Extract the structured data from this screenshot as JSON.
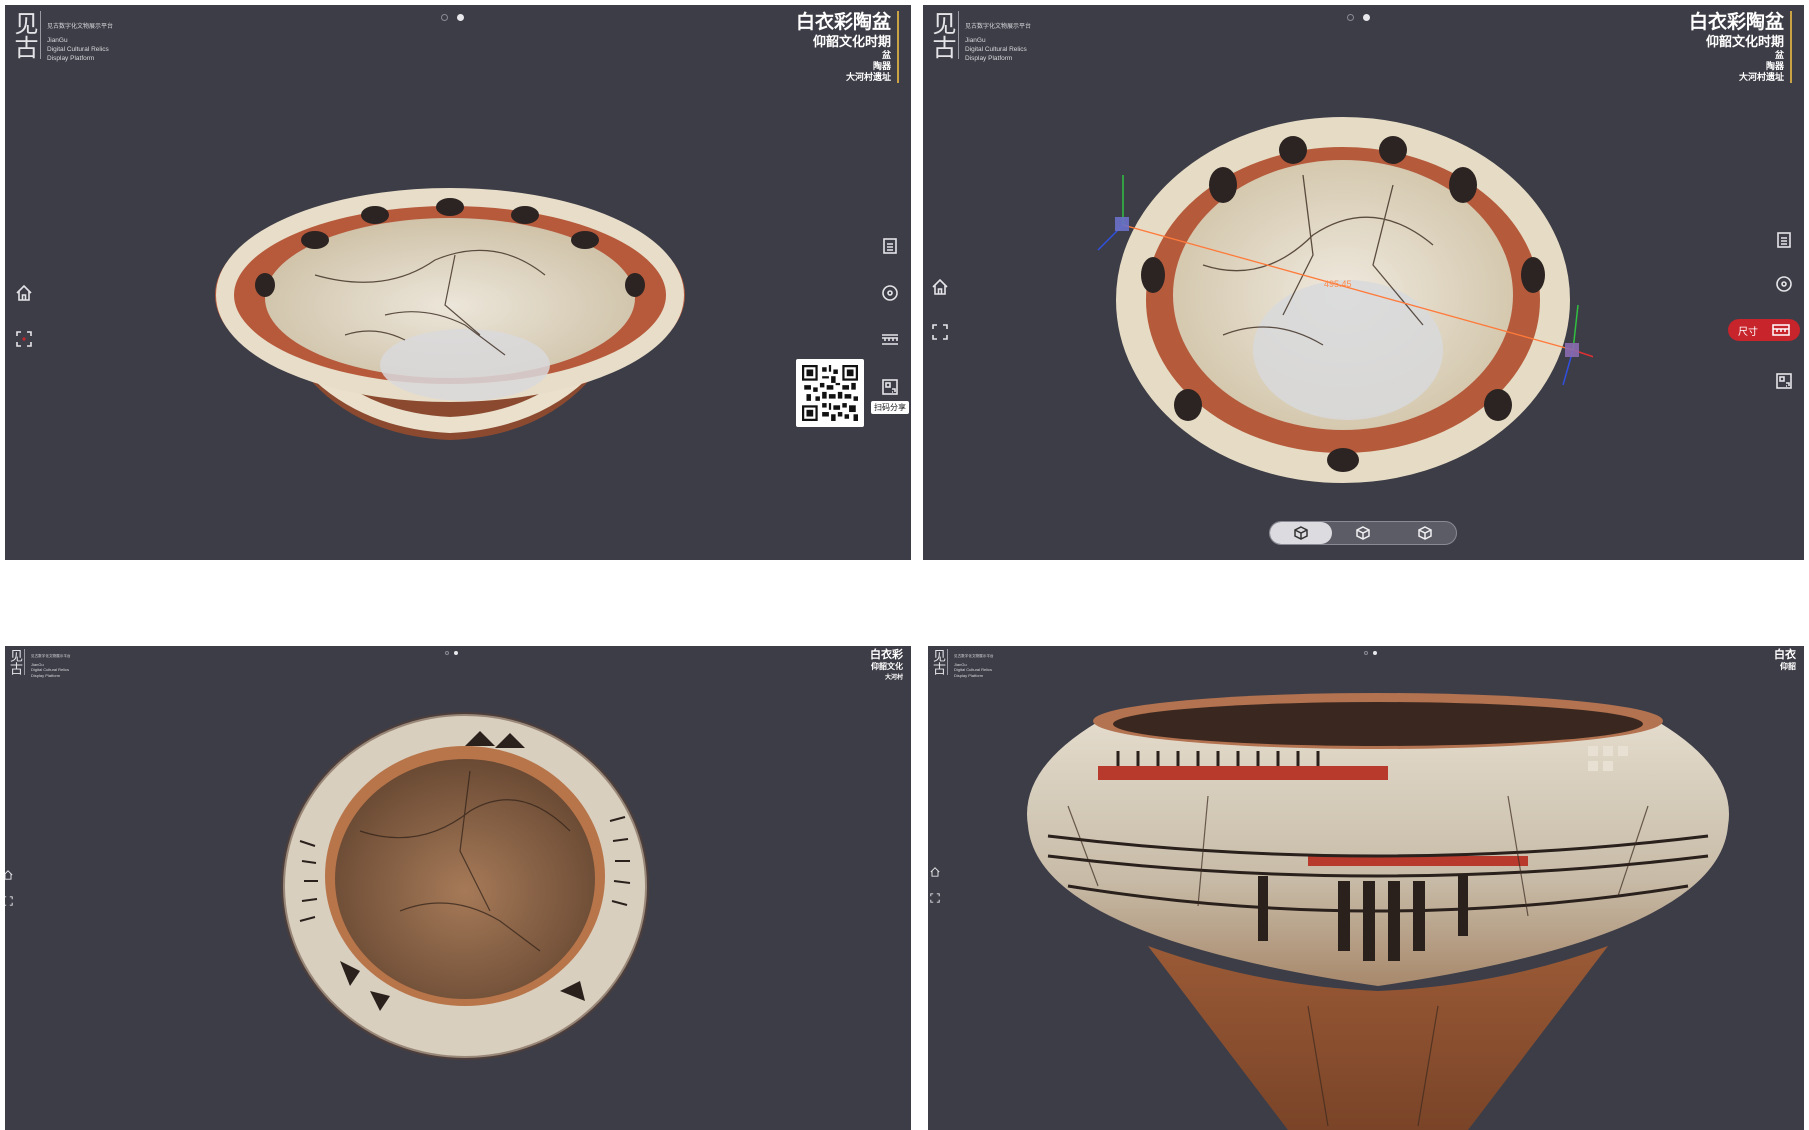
{
  "brand": {
    "glyph": "见古",
    "cn_tagline": "见古数字化文物展示平台",
    "name_en_1": "JianGu",
    "name_en_2": "Digital Cultural Relics",
    "name_en_3": "Display Platform"
  },
  "artifact_a": {
    "title": "白衣彩陶盆",
    "culture": "仰韶文化时期",
    "type": "盆",
    "material": "陶器",
    "site": "大河村遗址"
  },
  "artifact_b": {
    "title": "白衣彩",
    "culture": "仰韶文化",
    "site": "大河村"
  },
  "artifact_c": {
    "title": "白衣",
    "culture": "仰韶"
  },
  "qr_tooltip": "扫码分享",
  "measure": {
    "label": "尺寸",
    "value": "495.45"
  },
  "icons": {
    "home": "home-icon",
    "fullscreen": "fullscreen-icon",
    "info": "document-icon",
    "rotate": "target-icon",
    "ruler": "ruler-icon",
    "qr": "qr-code-icon",
    "view_front": "cube-front-icon",
    "view_side": "cube-side-icon",
    "view_top": "cube-top-icon"
  },
  "colors": {
    "panel_bg": "#3d3d47",
    "accent_red": "#c8242c",
    "title_bar": "#c9a344"
  }
}
